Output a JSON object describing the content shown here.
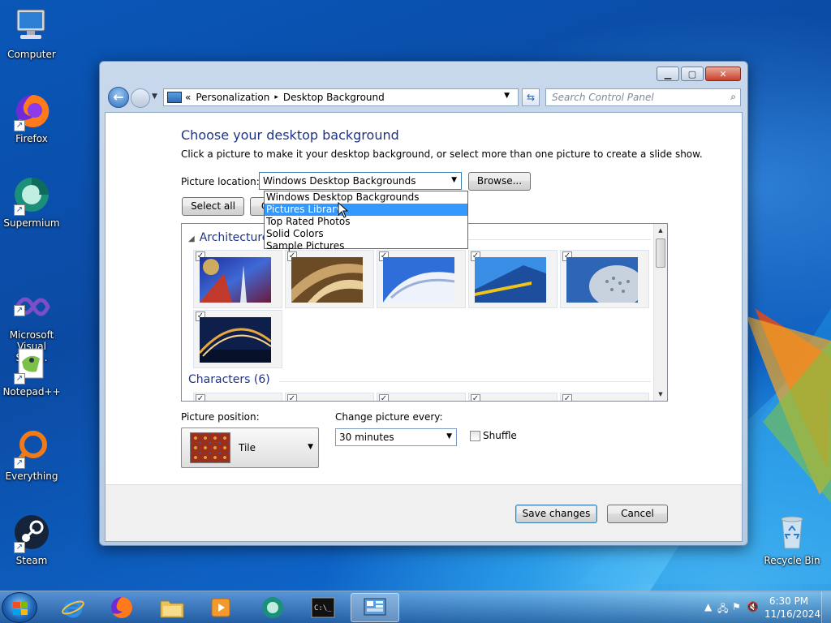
{
  "desktop": {
    "icons": [
      {
        "label": "Computer",
        "icon": "computer-icon"
      },
      {
        "label": "Firefox",
        "icon": "firefox-icon"
      },
      {
        "label": "Supermium",
        "icon": "supermium-icon"
      },
      {
        "label": "Microsoft\nVisual Stud...",
        "icon": "visual-studio-icon"
      },
      {
        "label": "Notepad++",
        "icon": "notepadpp-icon"
      },
      {
        "label": "Everything",
        "icon": "everything-icon"
      },
      {
        "label": "Steam",
        "icon": "steam-icon"
      }
    ],
    "recycle_bin": "Recycle Bin"
  },
  "window": {
    "caption_buttons": [
      "minimize-icon",
      "maximize-icon",
      "close-icon"
    ],
    "address": {
      "prefix": "«",
      "crumbs": [
        "Personalization",
        "Desktop Background"
      ],
      "separator": "▸"
    },
    "search_placeholder": "Search Control Panel",
    "heading": "Choose your desktop background",
    "description": "Click a picture to make it your desktop background, or select more than one picture to create a slide show.",
    "picture_location_label": "Picture location:",
    "picture_location_value": "Windows Desktop Backgrounds",
    "browse_label": "Browse...",
    "select_all_label": "Select all",
    "clear_all_label": "Clear all",
    "location_options": [
      "Windows Desktop Backgrounds",
      "Pictures Library",
      "Top Rated Photos",
      "Solid Colors",
      "Sample Pictures"
    ],
    "selected_option": "Pictures Library",
    "groups": [
      {
        "title": "Architecture (6)",
        "visible_title": "Architecture"
      },
      {
        "title": "Characters (6)"
      }
    ],
    "picture_position_label": "Picture position:",
    "picture_position_value": "Tile",
    "change_every_label": "Change picture every:",
    "change_every_value": "30 minutes",
    "shuffle_label": "Shuffle",
    "shuffle_checked": false,
    "save_label": "Save changes",
    "cancel_label": "Cancel"
  },
  "taskbar": {
    "apps": [
      "internet-explorer-icon",
      "firefox-icon",
      "explorer-folder-icon",
      "media-player-icon",
      "supermium-icon",
      "cmd-icon",
      "control-panel-icon"
    ],
    "active_app": "control-panel-icon",
    "time": "6:30 PM",
    "date": "11/16/2024"
  },
  "colors": {
    "heading_blue": "#1e3287",
    "selection_blue": "#3399ff"
  }
}
